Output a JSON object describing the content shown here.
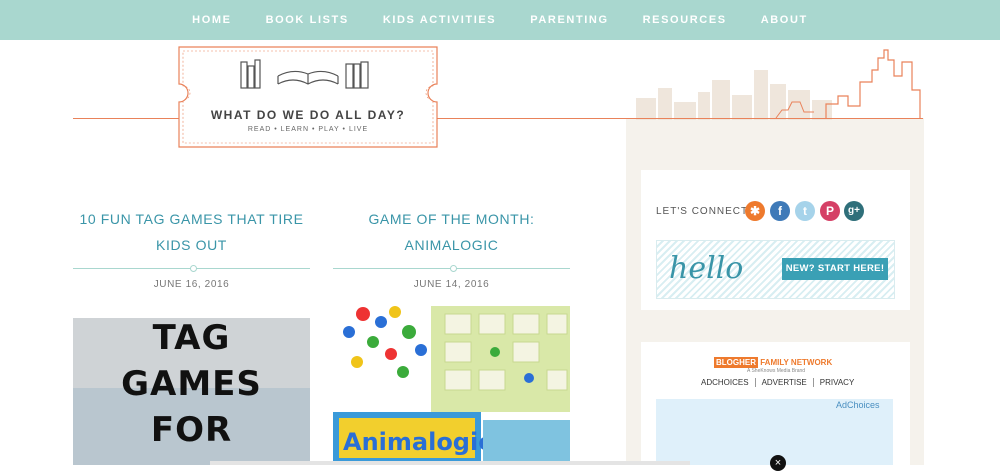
{
  "nav": {
    "items": [
      "HOME",
      "BOOK LISTS",
      "KIDS ACTIVITIES",
      "PARENTING",
      "RESOURCES",
      "ABOUT"
    ]
  },
  "logo": {
    "title": "WHAT DO WE DO ALL DAY?",
    "tagline": "READ • LEARN • PLAY • LIVE"
  },
  "posts": [
    {
      "title": "10 FUN TAG GAMES THAT TIRE KIDS OUT",
      "date": "JUNE 16, 2016",
      "image_text": [
        "TAG",
        "GAMES",
        "FOR"
      ]
    },
    {
      "title": "GAME OF THE MONTH: ANIMALOGIC",
      "date": "JUNE 14, 2016",
      "image_text": "Animalogic"
    }
  ],
  "sidebar": {
    "connect_label": "LET'S CONNECT",
    "social_icons": [
      "rss-icon",
      "facebook-icon",
      "twitter-icon",
      "pinterest-icon",
      "google-plus-icon"
    ],
    "hello_word": "hello",
    "hello_badge": "NEW? START HERE!",
    "ad": {
      "network_b": "BLOGHER",
      "network_f": "FAMILY NETWORK",
      "network_sub": "A SheKnows Media Brand",
      "links": [
        "ADCHOICES",
        "ADVERTISE",
        "PRIVACY"
      ],
      "adchoices": "AdChoices"
    }
  },
  "colors": {
    "accent": "#a9d7cf",
    "title": "#3a95a8",
    "orange": "#e9825a"
  }
}
